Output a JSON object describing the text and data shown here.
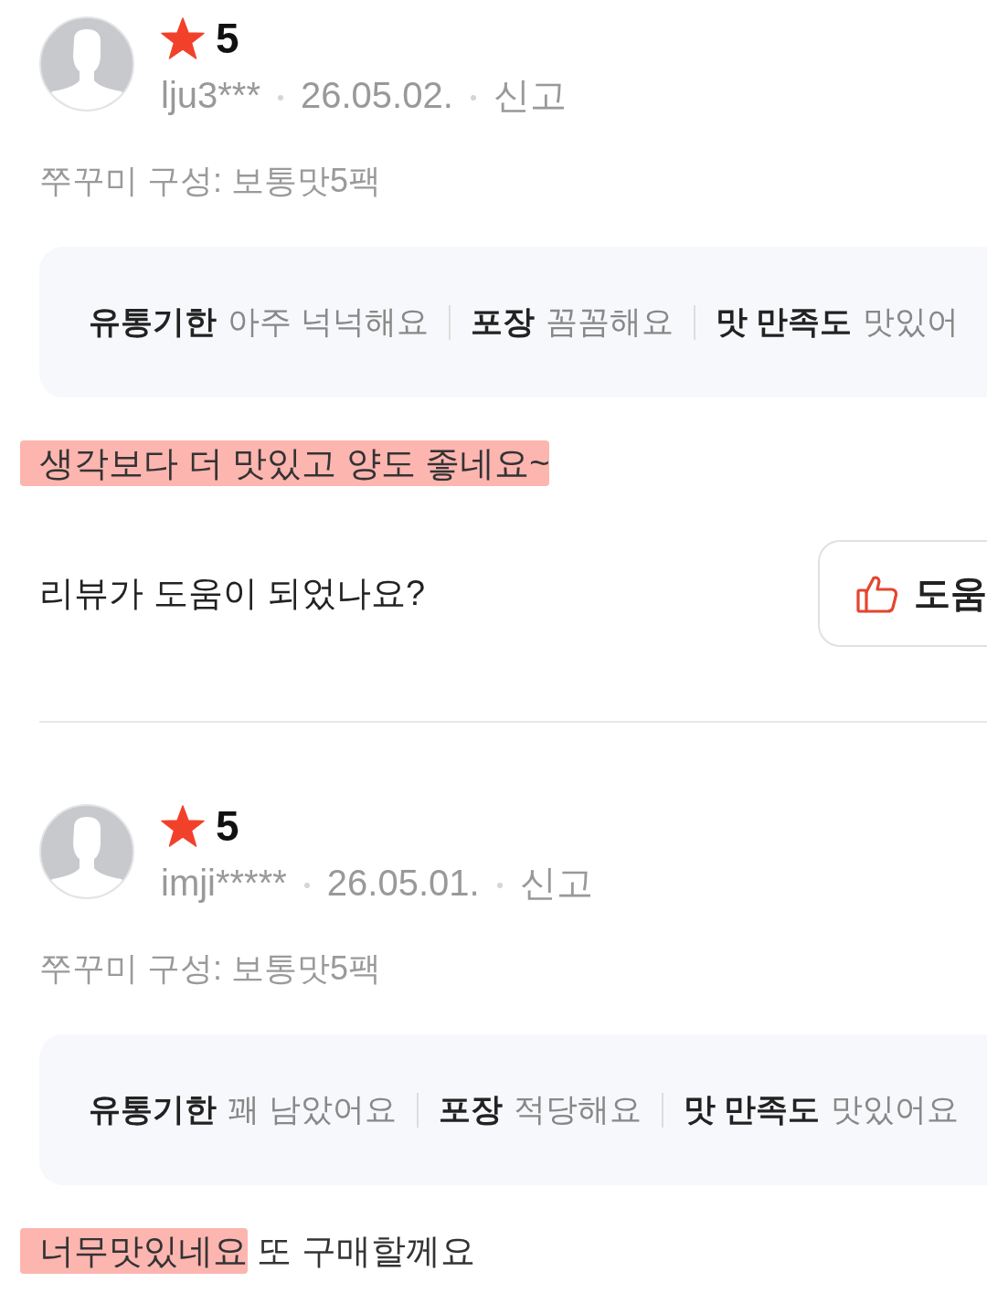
{
  "reviews": [
    {
      "rating": "5",
      "username": "lju3***",
      "date": "26.05.02.",
      "report": "신고",
      "option": "쭈꾸미 구성: 보통맛5팩",
      "summary": [
        {
          "label": "유통기한",
          "value": "아주 넉넉해요"
        },
        {
          "label": "포장",
          "value": "꼼꼼해요"
        },
        {
          "label": "맛 만족도",
          "value": "맛있어"
        }
      ],
      "text": [
        {
          "text": "생각보다 더 맛있고 양도 좋네요~",
          "highlighted": true
        }
      ],
      "helpful": {
        "question": "리뷰가 도움이 되었나요?",
        "button": "도움"
      }
    },
    {
      "rating": "5",
      "username": "imji*****",
      "date": "26.05.01.",
      "report": "신고",
      "option": "쭈꾸미 구성: 보통맛5팩",
      "summary": [
        {
          "label": "유통기한",
          "value": "꽤 남았어요"
        },
        {
          "label": "포장",
          "value": "적당해요"
        },
        {
          "label": "맛 만족도",
          "value": "맛있어요"
        }
      ],
      "text": [
        {
          "text": "너무맛있네요",
          "highlighted": true
        },
        {
          "text": "또 구매할께요",
          "highlighted": false
        }
      ]
    }
  ]
}
